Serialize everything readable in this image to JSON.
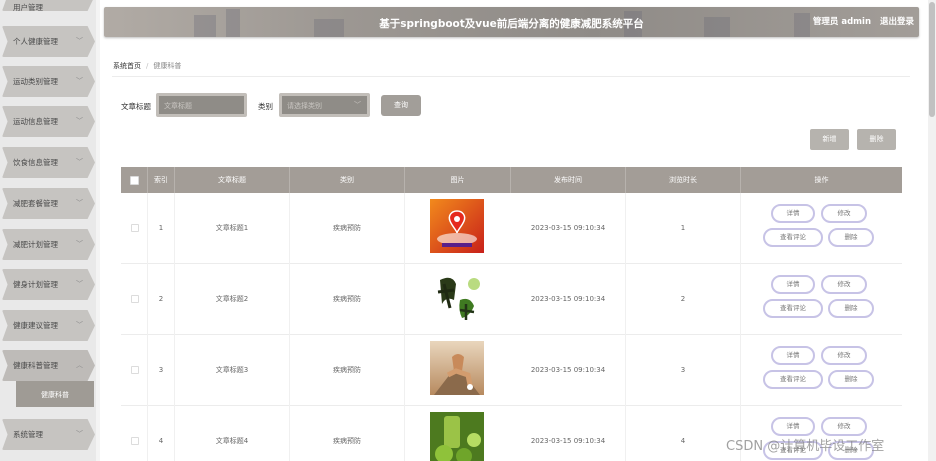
{
  "header": {
    "title": "基于springboot及vue前后端分离的健康减肥系统平台",
    "user": "管理员 admin",
    "logout": "退出登录"
  },
  "sidebar": {
    "partial_top": "用户管理",
    "items": [
      {
        "label": "个人健康管理"
      },
      {
        "label": "运动类别管理"
      },
      {
        "label": "运动信息管理"
      },
      {
        "label": "饮食信息管理"
      },
      {
        "label": "减肥套餐管理"
      },
      {
        "label": "减肥计划管理"
      },
      {
        "label": "健身计划管理"
      },
      {
        "label": "健康建议管理"
      },
      {
        "label": "健康科普管理"
      },
      {
        "label": "系统管理"
      }
    ],
    "sub_item": "健康科普"
  },
  "breadcrumb": {
    "home": "系统首页",
    "separator": "/",
    "current": "健康科普"
  },
  "search": {
    "title_label": "文章标题",
    "title_placeholder": "文章标题",
    "category_label": "类别",
    "category_placeholder": "请选择类别",
    "search_button": "查询"
  },
  "actions": {
    "add": "新增",
    "delete": "删除"
  },
  "table": {
    "columns": [
      "索引",
      "文章标题",
      "类别",
      "图片",
      "发布时间",
      "浏览时长",
      "操作"
    ],
    "rows": [
      {
        "index": "1",
        "title": "文章标题1",
        "category": "疾病预防",
        "image": "health-heart-image",
        "time": "2023-03-15 09:10:34",
        "duration": "1"
      },
      {
        "index": "2",
        "title": "文章标题2",
        "category": "疾病预防",
        "image": "jiankang-calligraphy-image",
        "time": "2023-03-15 09:10:34",
        "duration": "2"
      },
      {
        "index": "3",
        "title": "文章标题3",
        "category": "疾病预防",
        "image": "runner-image",
        "time": "2023-03-15 09:10:34",
        "duration": "3"
      },
      {
        "index": "4",
        "title": "文章标题4",
        "category": "疾病预防",
        "image": "green-fruit-image",
        "time": "2023-03-15 09:10:34",
        "duration": "4"
      }
    ],
    "row_buttons": {
      "detail": "详情",
      "edit": "修改",
      "comments": "查看评论",
      "delete": "删除"
    }
  },
  "watermark": "CSDN @计算机毕设工作室",
  "colors": {
    "header": "#9c9792",
    "table_head": "#a39d97",
    "button_outline": "#c7c3e6"
  }
}
